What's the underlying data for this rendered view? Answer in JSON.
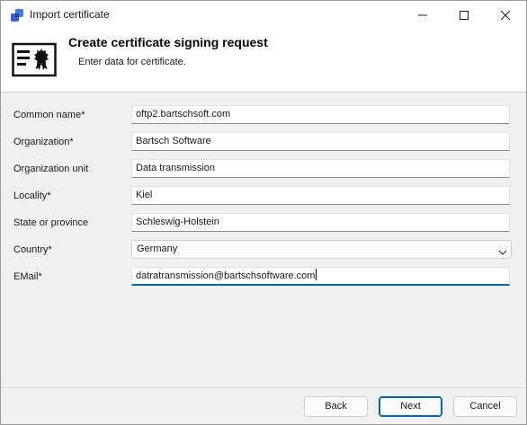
{
  "window": {
    "title": "Import certificate"
  },
  "banner": {
    "title": "Create certificate signing request",
    "subtitle": "Enter data for certificate."
  },
  "form": {
    "fields": [
      {
        "label": "Common name*",
        "value": "oftp2.bartschsoft.com"
      },
      {
        "label": "Organization*",
        "value": "Bartsch Software"
      },
      {
        "label": "Organization unit",
        "value": "Data transmission"
      },
      {
        "label": "Locality*",
        "value": "Kiel"
      },
      {
        "label": "State or province",
        "value": "Schleswig-Holstein"
      }
    ],
    "country": {
      "label": "Country*",
      "value": "Germany"
    },
    "email": {
      "label": "EMail*",
      "value": "datratransmission@bartschsoftware.com"
    }
  },
  "footer": {
    "back": "Back",
    "next": "Next",
    "cancel": "Cancel"
  },
  "colors": {
    "accent": "#0067c0",
    "banner_bg": "#ffffff",
    "dialog_bg": "#f0f0f0"
  }
}
